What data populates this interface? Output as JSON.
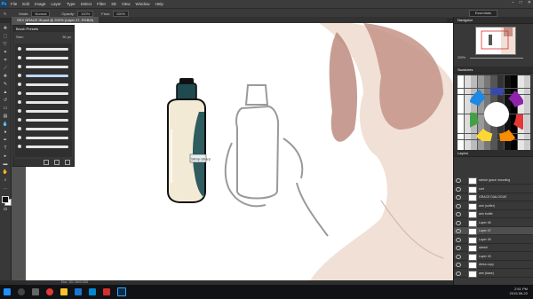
{
  "menu": [
    "File",
    "Edit",
    "Image",
    "Layer",
    "Type",
    "Select",
    "Filter",
    "3D",
    "View",
    "Window",
    "Help"
  ],
  "options": {
    "mode_label": "Mode:",
    "mode_value": "Normal",
    "opacity_label": "Opacity:",
    "opacity_value": "100%",
    "flow_label": "Flow:",
    "flow_value": "100%"
  },
  "workspace": "Essentials",
  "doc_tab": "SEX GRACE IN.psd @ 200% (Layer 47, RGB/8)",
  "brush_panel": {
    "title": "Brush Presets",
    "size_label": "Size:",
    "size_value": "30 px"
  },
  "status": "Doc: 121.1M/3.03G",
  "panels": {
    "navigator": "Navigator",
    "swatches": "Swatches",
    "layers": "Layers",
    "zoom": "200%"
  },
  "layers": [
    {
      "name": "sketch grace mounting",
      "sel": false
    },
    {
      "name": "sref",
      "sel": false
    },
    {
      "name": "GRACE DIALOGUE",
      "sel": false
    },
    {
      "name": "arm (softer)",
      "sel": false
    },
    {
      "name": "arm bottle",
      "sel": false
    },
    {
      "name": "Layer 46",
      "sel": false
    },
    {
      "name": "Layer 47",
      "sel": true
    },
    {
      "name": "Layer 45",
      "sel": false
    },
    {
      "name": "sketch",
      "sel": false
    },
    {
      "name": "Layer 43",
      "sel": false
    },
    {
      "name": "dress copy",
      "sel": false
    },
    {
      "name": "arm (base)",
      "sel": false
    }
  ],
  "label_text": "Slimp-Sharp",
  "clock": {
    "time": "2:51 PM",
    "date": "2019-06-22"
  },
  "colors": {
    "bottle_cap": "#1f4a4f",
    "skin": "#e8c7b8",
    "hair": "#b5837a"
  },
  "icons": [
    "windows-start-icon",
    "search-icon",
    "task-view-icon",
    "chrome-icon",
    "folder-icon",
    "store-icon",
    "mail-icon",
    "media-icon",
    "photoshop-icon"
  ]
}
